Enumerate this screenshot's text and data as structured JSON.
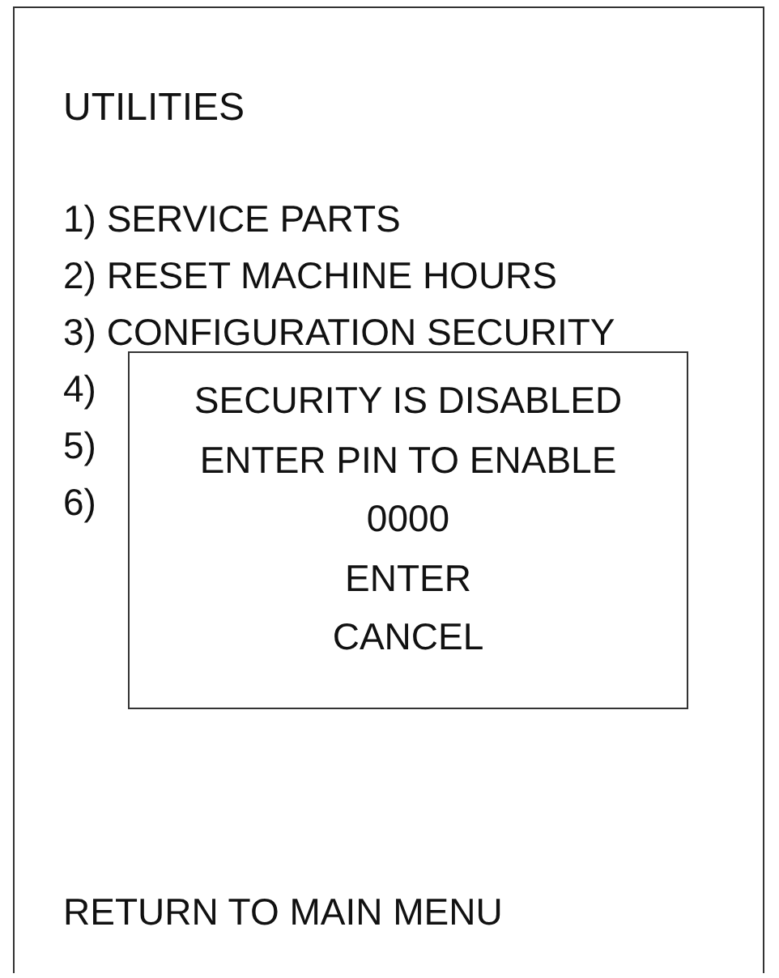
{
  "screen": {
    "title": "UTILITIES",
    "menu_items": [
      {
        "label": "1) SERVICE PARTS"
      },
      {
        "label": "2) RESET MACHINE HOURS"
      },
      {
        "label": "3) CONFIGURATION SECURITY"
      },
      {
        "label": "4)"
      },
      {
        "label": "5)"
      },
      {
        "label": "6)"
      }
    ],
    "footer_link": "RETURN TO MAIN MENU"
  },
  "dialog": {
    "messages": [
      "SECURITY IS DISABLED",
      "ENTER PIN TO ENABLE"
    ],
    "pin": "0000",
    "buttons": [
      "ENTER",
      "CANCEL"
    ]
  }
}
